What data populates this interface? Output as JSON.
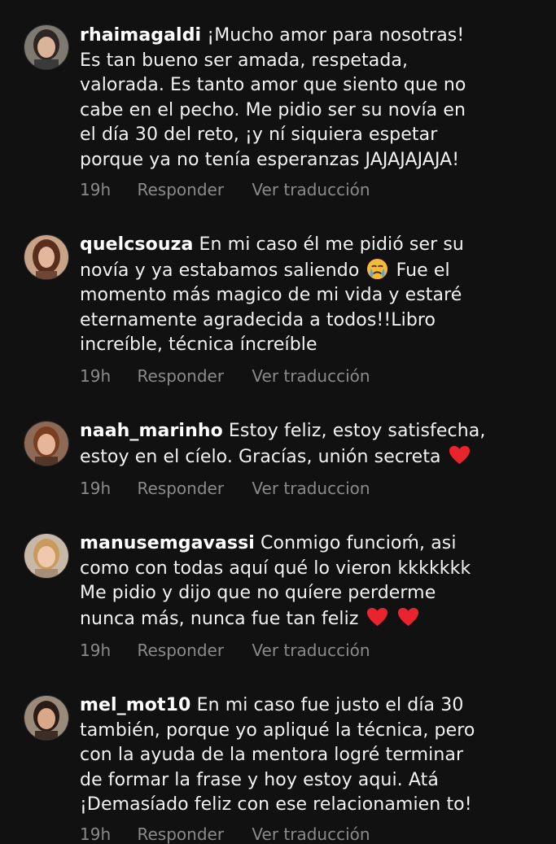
{
  "comments": [
    {
      "username": "rhaimagaldi",
      "text": "¡Mucho amor para nosotras! Es tan bueno ser amada, respetada, valorada. Es tanto amor que siento que no cabe en el pecho. Me pidio ser su novía en el día 30 del reto, ¡y ní siquiera espetar porque ya no tenía esperanzas JAJAJAJAJA!",
      "lines": [
        "¡Mucho amor para nosotras!",
        "Es tan bueno ser amada, respetada,",
        "valorada. Es tanto amor que siento que no",
        "cabe en el pecho. Me pidio ser su novía en",
        "el día 30 del reto, ¡y ní siquiera espetar",
        "porque ya no tenía esperanzas JAJAJAJAJA!"
      ],
      "time": "19h",
      "reply": "Responder",
      "translate": "Ver traducción"
    },
    {
      "username": "quelcsouza",
      "lines": [
        "En mi caso él me pidió ser su",
        "novía y ya estabamos saliendo",
        "Fue el",
        "momento más magico de mi vida y estaré",
        "eternamente agradecida a todos!!Libro",
        "increíble, técnica íncreíble"
      ],
      "emoji": "crying-face",
      "time": "19h",
      "reply": "Responder",
      "translate": "Ver traducción"
    },
    {
      "username": "naah_marinho",
      "lines": [
        "Estoy feliz, estoy satisfecha,",
        "estoy en el cíelo. Gracías, unión secreta"
      ],
      "emoji": "red-heart",
      "time": "19h",
      "reply": "Responder",
      "translate": "Ver traduccion"
    },
    {
      "username": "manusemgavassi",
      "lines": [
        "Conmigo funcioḿ, asi",
        "como con todas aquí qué lo vieron kkkkkkk",
        "Me pidio y dijo que no quíere perderme",
        "nunca más, nunca fue tan feliz"
      ],
      "emoji": "red-heart",
      "time": "19h",
      "reply": "Responder",
      "translate": "Ver traducción"
    },
    {
      "username": "mel_mot10",
      "lines": [
        "En mi caso fue justo el día 30",
        "también, porque yo apliqué la técnica, pero",
        "con la ayuda de la mentora logré terminar",
        "de formar la frase y hoy estoy aqui. Atá",
        "¡Demasíado feliz con ese relacionamien to!"
      ],
      "time": "19h",
      "reply": "Responder",
      "translate": "Ver traducción"
    }
  ],
  "colors": {
    "background": "#111111",
    "text": "#f2f2f2",
    "muted": "#8a8a8a",
    "heart": "#e8242c"
  }
}
